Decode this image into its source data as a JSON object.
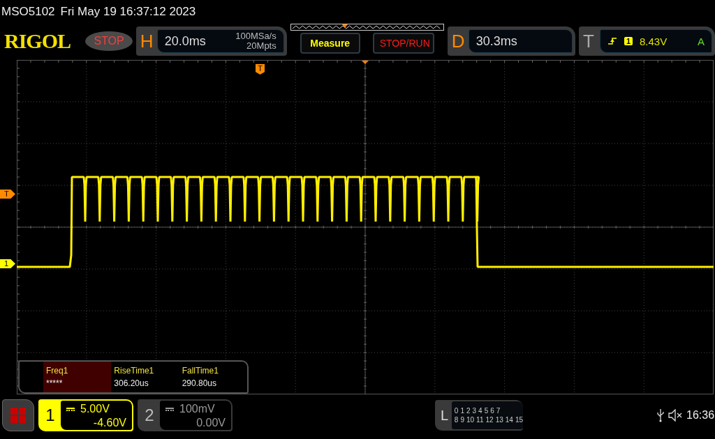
{
  "status_line": {
    "model": "MSO5102",
    "datetime": "Fri May 19 16:37:12 2023"
  },
  "brand": "RIGOL",
  "run_state": {
    "label": "STOP"
  },
  "horizontal": {
    "letter": "H",
    "timebase": "20.0ms",
    "sample_rate": "100MSa/s",
    "memory_depth": "20Mpts"
  },
  "buttons": [
    {
      "label": "Measure",
      "kind": "measure"
    },
    {
      "label": "STOP/RUN",
      "kind": "run"
    }
  ],
  "delay": {
    "letter": "D",
    "value": "30.3ms"
  },
  "trigger": {
    "letter": "T",
    "source": "1",
    "level": "8.43V",
    "mode": "A"
  },
  "markers": [
    {
      "label": "T",
      "kind": "trigger-position"
    },
    {
      "label": "T",
      "kind": "trigger-level"
    },
    {
      "label": "1",
      "kind": "channel"
    }
  ],
  "measurements": [
    {
      "name": "Freq1",
      "value": "*****",
      "selected": true
    },
    {
      "name": "RiseTime1",
      "value": "306.20us",
      "selected": false
    },
    {
      "name": "FallTime1",
      "value": "290.80us",
      "selected": false
    }
  ],
  "channels": [
    {
      "number": "1",
      "scale": "5.00V",
      "offset": "-4.60V",
      "on": true
    },
    {
      "number": "2",
      "scale": "100mV",
      "offset": "0.00V",
      "on": false
    }
  ],
  "logic": {
    "letter": "L",
    "row_1": [
      "0",
      "1",
      "2",
      "3",
      "4",
      "5",
      "6",
      "7"
    ],
    "row_2": [
      "8",
      "9",
      "10",
      "11",
      "12",
      "13",
      "14",
      "15"
    ]
  },
  "system_tray": {
    "time": "16:36"
  }
}
